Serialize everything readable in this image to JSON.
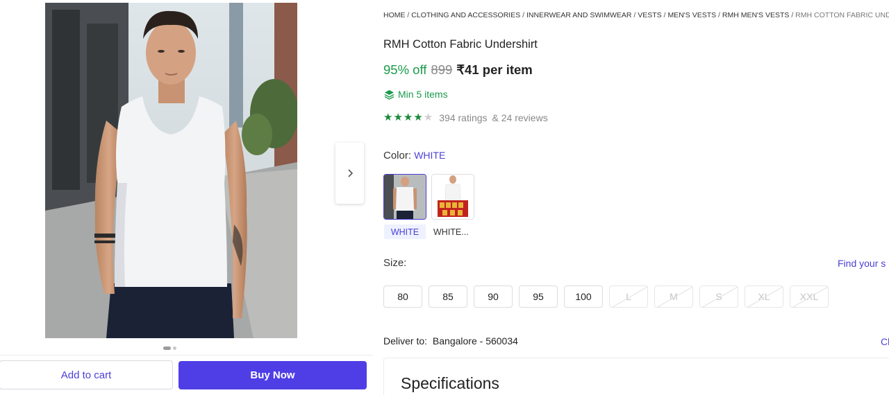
{
  "breadcrumb": [
    {
      "label": "HOME"
    },
    {
      "label": "CLOTHING AND ACCESSORIES"
    },
    {
      "label": "INNERWEAR AND SWIMWEAR"
    },
    {
      "label": "VESTS"
    },
    {
      "label": "MEN'S VESTS"
    },
    {
      "label": "RMH MEN'S VESTS"
    },
    {
      "label": "RMH COTTON FABRIC UNDERSHIRT"
    }
  ],
  "product": {
    "title": "RMH Cotton Fabric Undershirt",
    "discount": "95% off",
    "mrp": "899",
    "price": "₹41 per item",
    "min_order": "Min 5 items",
    "rating": {
      "stars": 4,
      "max": 5,
      "ratings_text": "394 ratings",
      "reviews_text": "& 24 reviews"
    }
  },
  "gallery": {
    "image_count": 2,
    "active_index": 0
  },
  "color": {
    "label": "Color:",
    "selected": "WHITE",
    "options": [
      {
        "label": "WHITE",
        "selected": true
      },
      {
        "label": "WHITE...",
        "selected": false
      }
    ]
  },
  "size": {
    "label": "Size:",
    "chart_link": "Find your s",
    "options": [
      {
        "label": "80",
        "available": true
      },
      {
        "label": "85",
        "available": true
      },
      {
        "label": "90",
        "available": true
      },
      {
        "label": "95",
        "available": true
      },
      {
        "label": "100",
        "available": true
      },
      {
        "label": "L",
        "available": false
      },
      {
        "label": "M",
        "available": false
      },
      {
        "label": "S",
        "available": false
      },
      {
        "label": "XL",
        "available": false
      },
      {
        "label": "XXL",
        "available": false
      }
    ]
  },
  "delivery": {
    "label": "Deliver to:",
    "location": "Bangalore - 560034",
    "change_label": "Cl"
  },
  "actions": {
    "add_to_cart": "Add to cart",
    "buy_now": "Buy Now"
  },
  "specs": {
    "title": "Specifications"
  },
  "colors": {
    "accent": "#4f3ee6",
    "link": "#4b3fd6",
    "success": "#1a9b4b",
    "star": "#1a8a3b"
  }
}
